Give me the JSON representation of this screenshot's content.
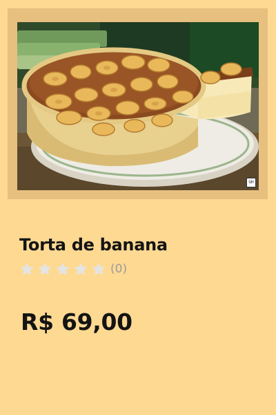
{
  "product": {
    "image_alt": "Torta de banana",
    "image_badge": "GH",
    "name": "Torta de banana",
    "rating": {
      "stars_filled": 0,
      "stars_total": 5,
      "count_text": "(0)"
    },
    "price": "R$ 69,00"
  },
  "colors": {
    "background": "#fed992",
    "frame": "#e7c07f",
    "star_empty": "#e4e4e4",
    "text": "#141414",
    "muted": "#9c9c9c"
  }
}
